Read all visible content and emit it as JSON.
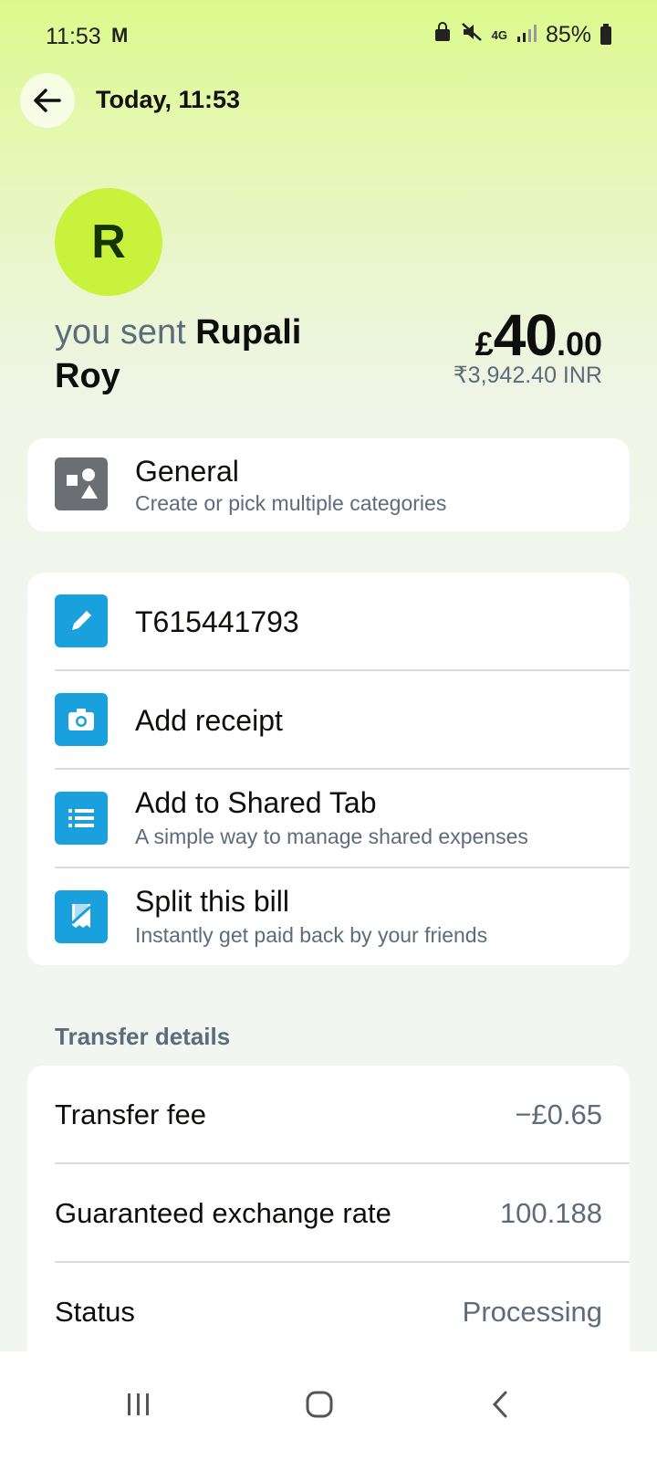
{
  "status_bar": {
    "time": "11:53",
    "carrier_icon": "M",
    "network": "4G",
    "battery": "85%"
  },
  "header": {
    "title": "Today, 11:53"
  },
  "transaction": {
    "avatar_initial": "R",
    "sent_prefix": "you sent",
    "recipient": "Rupali Roy",
    "amount_currency": "£",
    "amount_int": "40",
    "amount_dec": ".00",
    "amount_converted": "₹3,942.40 INR"
  },
  "category": {
    "title": "General",
    "subtitle": "Create or pick multiple categories"
  },
  "actions": [
    {
      "title": "T615441793",
      "subtitle": ""
    },
    {
      "title": "Add receipt",
      "subtitle": ""
    },
    {
      "title": "Add to Shared Tab",
      "subtitle": "A simple way to manage shared expenses"
    },
    {
      "title": "Split this bill",
      "subtitle": "Instantly get paid back by your friends"
    }
  ],
  "transfer_details": {
    "section_title": "Transfer details",
    "rows": [
      {
        "label": "Transfer fee",
        "value": "−£0.65"
      },
      {
        "label": "Guaranteed exchange rate",
        "value": "100.188"
      },
      {
        "label": "Status",
        "value": "Processing"
      }
    ]
  },
  "colors": {
    "accent_blue": "#1aa1dd",
    "avatar_green": "#c8f23c",
    "category_gray": "#6b6f73"
  }
}
